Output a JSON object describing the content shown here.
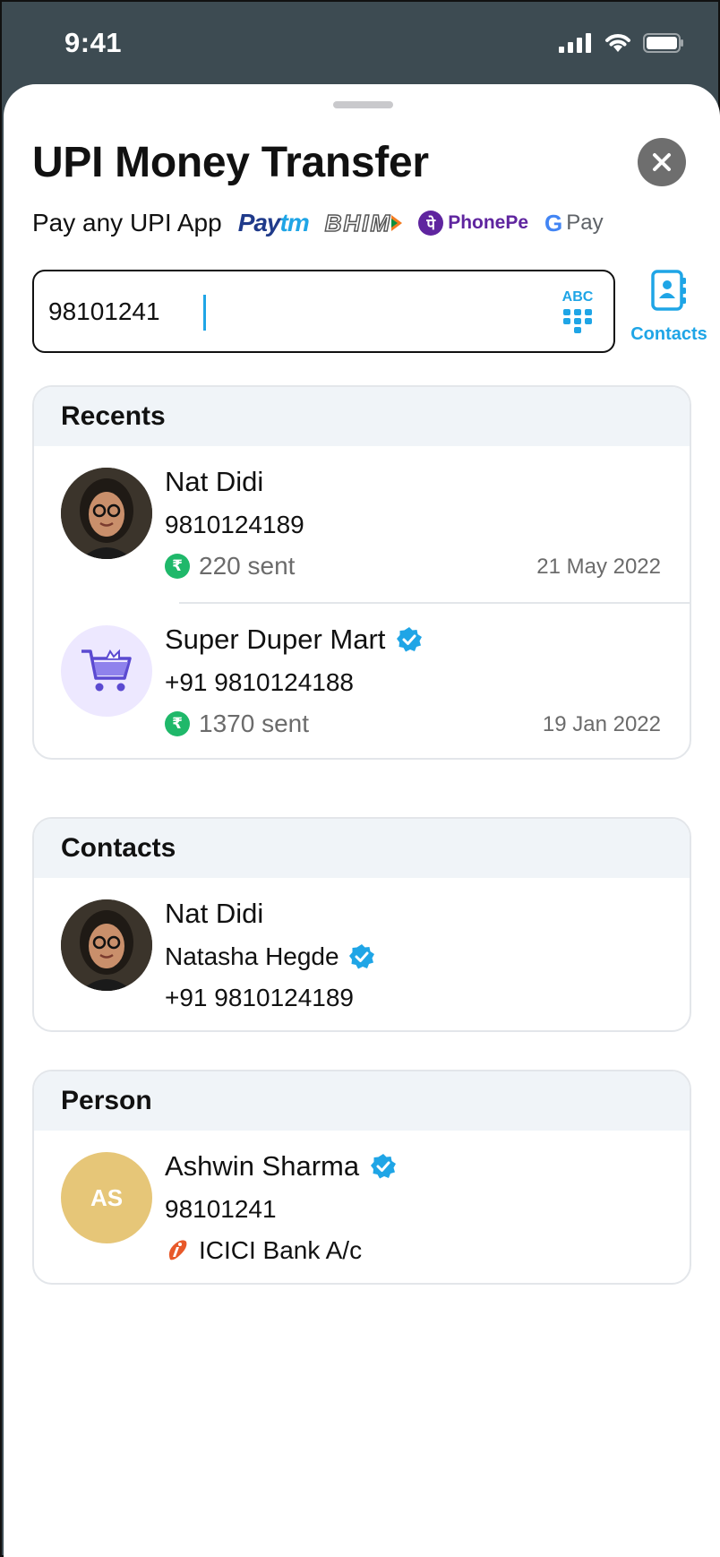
{
  "status_bar": {
    "time": "9:41"
  },
  "header": {
    "title": "UPI Money Transfer",
    "pay_label": "Pay any UPI App",
    "apps": {
      "paytm_pay": "Pay",
      "paytm_tm": "tm",
      "bhim": "BHIM",
      "phonepe": "PhonePe",
      "gpay_g": "G",
      "gpay_text": "Pay"
    }
  },
  "search": {
    "value": "98101241",
    "keyboard_toggle": "ABC"
  },
  "contacts_button": {
    "label": "Contacts"
  },
  "recents": {
    "title": "Recents",
    "items": [
      {
        "name": "Nat Didi",
        "number": "9810124189",
        "amount": "220 sent",
        "date": "21 May 2022"
      },
      {
        "name": "Super Duper Mart",
        "number": "+91 9810124188",
        "amount": "1370 sent",
        "date": "19 Jan 2022"
      }
    ]
  },
  "contacts": {
    "title": "Contacts",
    "items": [
      {
        "name": "Nat Didi",
        "full_name": "Natasha Hegde",
        "number": "+91 9810124189"
      }
    ]
  },
  "person": {
    "title": "Person",
    "items": [
      {
        "initials": "AS",
        "name": "Ashwin Sharma",
        "number": "98101241",
        "bank": "ICICI Bank A/c"
      }
    ]
  },
  "colors": {
    "accent": "#1fa5e6",
    "verified": "#1fa5e6",
    "rupee_badge": "#1fb86a",
    "initials_avatar": "#e6c678",
    "section_header_bg": "#f0f4f8"
  },
  "icons": {
    "close": "close-icon",
    "contacts": "contact-book-icon",
    "keypad": "keypad-icon",
    "verified": "verified-badge-icon",
    "rupee": "rupee-icon",
    "bank": "icici-bank-icon",
    "cart": "shopping-cart-icon"
  }
}
